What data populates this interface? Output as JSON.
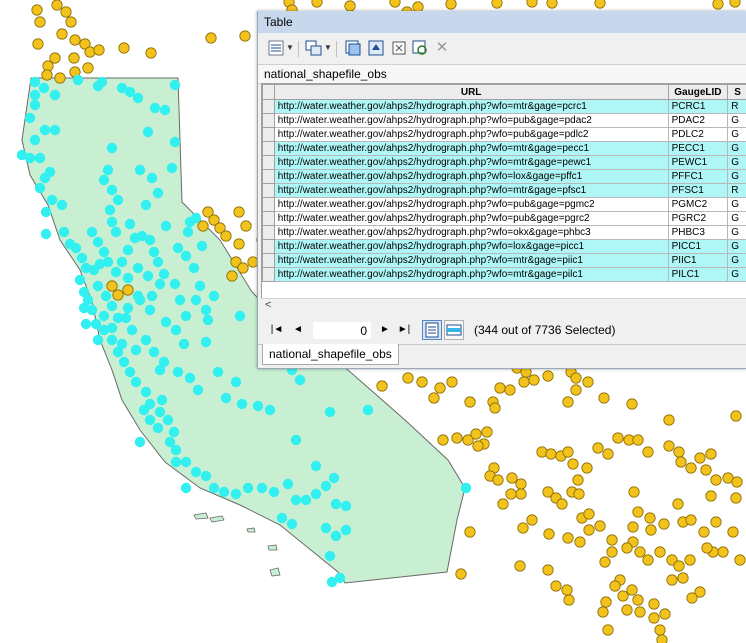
{
  "window": {
    "title": "Table"
  },
  "toolbar": {
    "buttons": [
      {
        "icon": "table-options-icon",
        "has_dropdown": true
      },
      {
        "icon": "related-tables-icon",
        "has_dropdown": true
      },
      {
        "icon": "select-by-attributes-icon"
      },
      {
        "icon": "switch-selection-icon"
      },
      {
        "icon": "clear-selection-icon"
      },
      {
        "icon": "zoom-to-selected-icon"
      },
      {
        "icon": "delete-selected-icon"
      }
    ]
  },
  "layer_name": "national_shapefile_obs",
  "grid": {
    "columns": [
      "URL",
      "GaugeLID",
      "S"
    ],
    "rows": [
      {
        "url": "http://water.weather.gov/ahps2/hydrograph.php?wfo=mtr&gage=pcrc1",
        "lid": "PCRC1",
        "s": "R",
        "selected": true
      },
      {
        "url": "http://water.weather.gov/ahps2/hydrograph.php?wfo=pub&gage=pdac2",
        "lid": "PDAC2",
        "s": "G",
        "selected": false
      },
      {
        "url": "http://water.weather.gov/ahps2/hydrograph.php?wfo=pub&gage=pdlc2",
        "lid": "PDLC2",
        "s": "G",
        "selected": false
      },
      {
        "url": "http://water.weather.gov/ahps2/hydrograph.php?wfo=mtr&gage=pecc1",
        "lid": "PECC1",
        "s": "G",
        "selected": true
      },
      {
        "url": "http://water.weather.gov/ahps2/hydrograph.php?wfo=mtr&gage=pewc1",
        "lid": "PEWC1",
        "s": "G",
        "selected": true
      },
      {
        "url": "http://water.weather.gov/ahps2/hydrograph.php?wfo=lox&gage=pffc1",
        "lid": "PFFC1",
        "s": "G",
        "selected": true
      },
      {
        "url": "http://water.weather.gov/ahps2/hydrograph.php?wfo=mtr&gage=pfsc1",
        "lid": "PFSC1",
        "s": "R",
        "selected": true
      },
      {
        "url": "http://water.weather.gov/ahps2/hydrograph.php?wfo=pub&gage=pgmc2",
        "lid": "PGMC2",
        "s": "G",
        "selected": false
      },
      {
        "url": "http://water.weather.gov/ahps2/hydrograph.php?wfo=pub&gage=pgrc2",
        "lid": "PGRC2",
        "s": "G",
        "selected": false
      },
      {
        "url": "http://water.weather.gov/ahps2/hydrograph.php?wfo=okx&gage=phbc3",
        "lid": "PHBC3",
        "s": "G",
        "selected": false
      },
      {
        "url": "http://water.weather.gov/ahps2/hydrograph.php?wfo=lox&gage=picc1",
        "lid": "PICC1",
        "s": "G",
        "selected": true
      },
      {
        "url": "http://water.weather.gov/ahps2/hydrograph.php?wfo=mtr&gage=piic1",
        "lid": "PIIC1",
        "s": "G",
        "selected": true
      },
      {
        "url": "http://water.weather.gov/ahps2/hydrograph.php?wfo=mtr&gage=pilc1",
        "lid": "PILC1",
        "s": "G",
        "selected": true
      }
    ]
  },
  "scrollbar": {
    "left_arrow": "<"
  },
  "navigation": {
    "first": "|◄",
    "prev": "◄",
    "next": "►",
    "last": "►|",
    "record": "0",
    "selection_status": "(344 out of 7736 Selected)"
  },
  "tab": {
    "label": "national_shapefile_obs"
  },
  "colors": {
    "california_fill": "#c8efd1",
    "selected_point": "#33f0f0",
    "unselected_point": "#f2c21d",
    "selected_row": "#aff7f7"
  }
}
